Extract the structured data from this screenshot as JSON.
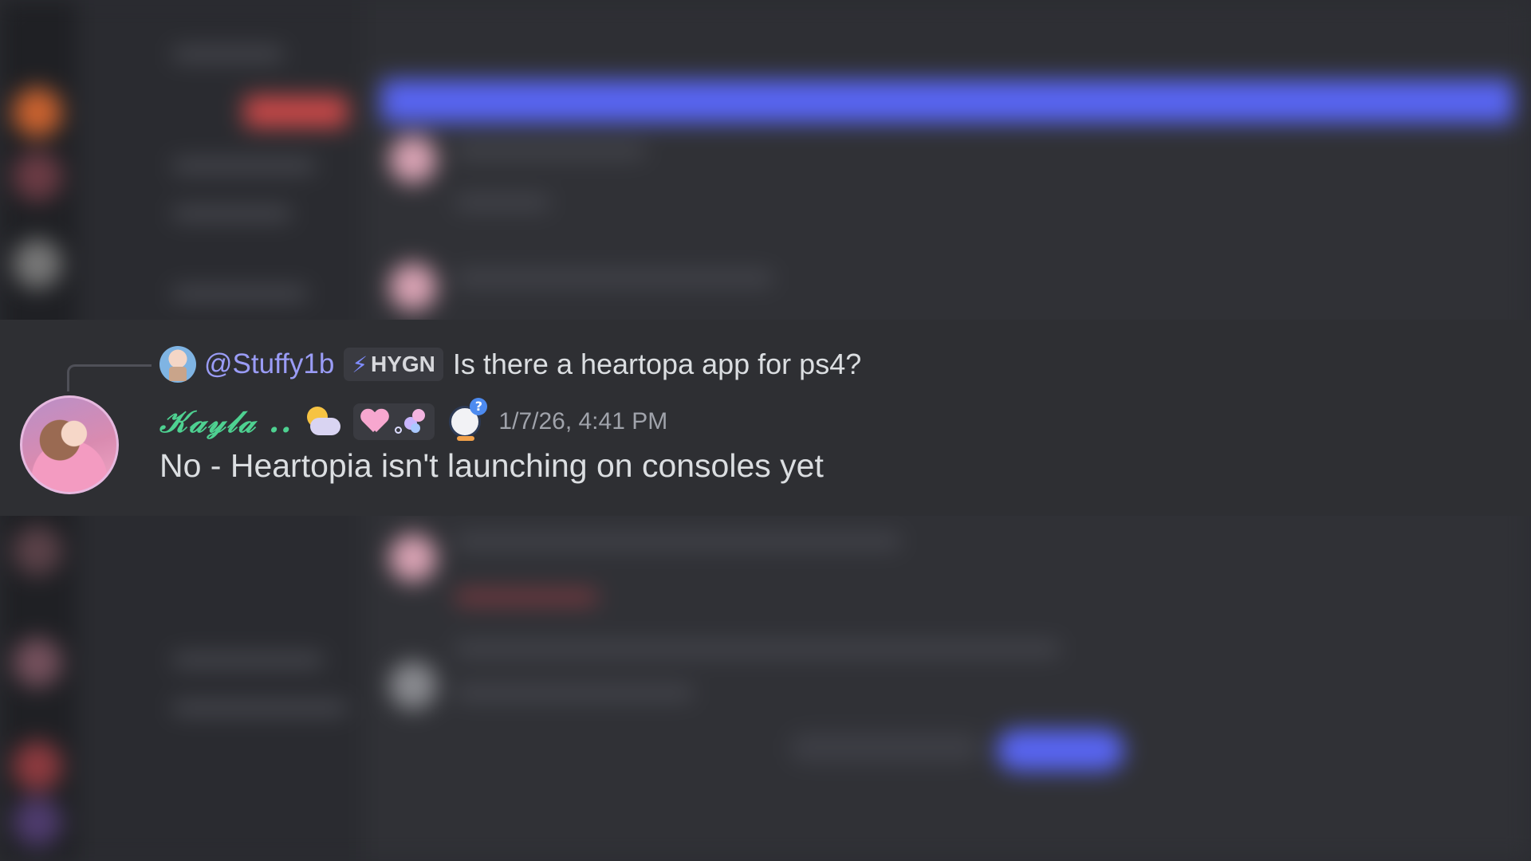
{
  "reply": {
    "mention": "@Stuffy1b",
    "tag_label": "HYGN",
    "tag_icon": "lightning-bolt-icon",
    "text": "Is there a heartopa app for ps4?"
  },
  "message": {
    "author": "𝒦𝒶𝓎𝓁𝒶 ..",
    "author_color": "#4ed191",
    "timestamp": "1/7/26, 4:41 PM",
    "content": "No - Heartopia isn't launching on consoles yet",
    "badges": [
      "sun-behind-cloud-icon",
      "pink-heart-icon",
      "bubbles-icon",
      "penguin-question-icon"
    ]
  },
  "colors": {
    "mention": "#9a9cf6",
    "accent": "#5865f2",
    "background": "#2e2f33"
  }
}
